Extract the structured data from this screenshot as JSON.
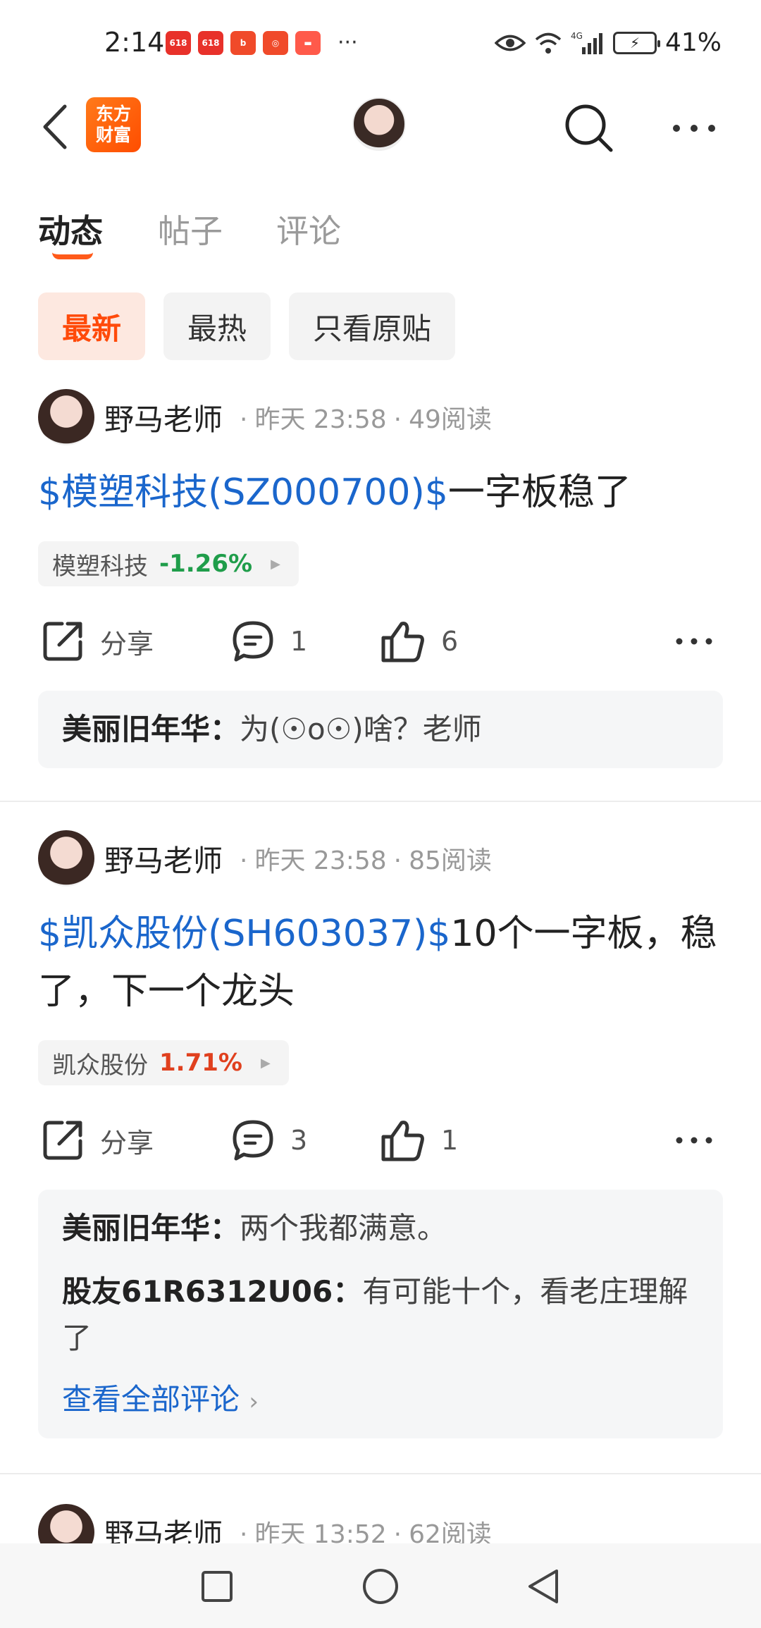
{
  "status_bar": {
    "time": "2:14",
    "app_badges": [
      "618",
      "618",
      "bilibili",
      "app",
      "HUAWEI"
    ],
    "network": "4G",
    "battery": "41%"
  },
  "header": {
    "brand_logo_line1": "东方",
    "brand_logo_line2": "财富",
    "icons": [
      "back-icon",
      "search-icon",
      "more-icon"
    ]
  },
  "tabs": [
    {
      "label": "动态",
      "active": true
    },
    {
      "label": "帖子",
      "active": false
    },
    {
      "label": "评论",
      "active": false
    }
  ],
  "filters": [
    {
      "label": "最新",
      "active": true
    },
    {
      "label": "最热",
      "active": false
    },
    {
      "label": "只看原贴",
      "active": false
    }
  ],
  "posts": [
    {
      "author": "野马老师",
      "time": "昨天 23:58",
      "reads": "49阅读",
      "stock_link": "$模塑科技(SZ000700)$",
      "text": "一字板稳了",
      "tag_name": "模塑科技",
      "tag_change": "-1.26%",
      "share_label": "分享",
      "comment_count": "1",
      "like_count": "6",
      "comments": [
        {
          "name": "美丽旧年华：",
          "text": "为(☉o☉)啥？老师"
        }
      ]
    },
    {
      "author": "野马老师",
      "time": "昨天 23:58",
      "reads": "85阅读",
      "stock_link": "$凯众股份(SH603037)$",
      "text": "10个一字板，稳了，下一个龙头",
      "tag_name": "凯众股份",
      "tag_change": "1.71%",
      "share_label": "分享",
      "comment_count": "3",
      "like_count": "1",
      "comments": [
        {
          "name": "美丽旧年华：",
          "text": "两个我都满意。"
        },
        {
          "name": "股友61R6312U06：",
          "text": "有可能十个，看老庄理解了"
        }
      ],
      "view_all": "查看全部评论"
    },
    {
      "author": "野马老师",
      "time": "昨天 13:52",
      "reads": "62阅读"
    }
  ],
  "colors": {
    "accent": "#ff4a0a",
    "link": "#1a66cc",
    "up": "#e0401e",
    "down": "#1f9d4a"
  }
}
